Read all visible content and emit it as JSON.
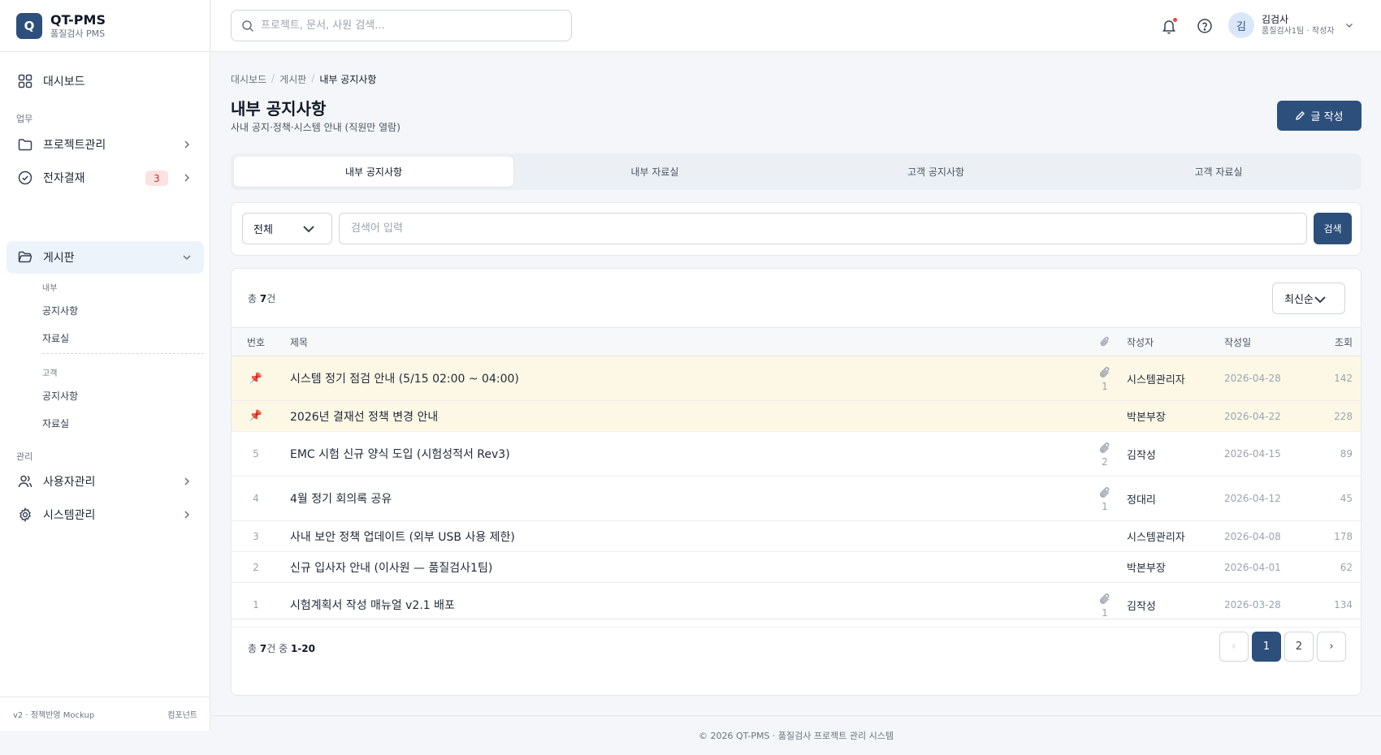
{
  "brand": {
    "logo_letter": "Q",
    "name": "QT-PMS",
    "subtitle": "품질검사 PMS"
  },
  "sidebar": {
    "dashboard": "대시보드",
    "section_work": "업무",
    "items": [
      {
        "label": "프로젝트관리",
        "icon": "folder-icon"
      },
      {
        "label": "전자결재",
        "icon": "check-circle-icon",
        "badge": "3"
      },
      {
        "label": "게시판",
        "icon": "folder-open-icon"
      }
    ],
    "board_sub": {
      "internal_label": "내부",
      "internal_items": [
        "공지사항",
        "자료실"
      ],
      "customer_label": "고객",
      "customer_items": [
        "공지사항",
        "자료실"
      ]
    },
    "section_admin": "관리",
    "admin_items": [
      {
        "label": "사용자관리",
        "icon": "users-icon"
      },
      {
        "label": "시스템관리",
        "icon": "gear-icon"
      }
    ],
    "footer_left": "v2 · 정책반영 Mockup",
    "footer_right": "컴포넌트"
  },
  "topbar": {
    "search_placeholder": "프로젝트, 문서, 사원 검색...",
    "user": {
      "avatar": "김",
      "name": "김검사",
      "role": "품질검사1팀 · 작성자"
    }
  },
  "breadcrumb": [
    "대시보드",
    "게시판",
    "내부 공지사항"
  ],
  "page": {
    "title": "내부 공지사항",
    "subtitle": "사내 공지·정책·시스템 안내 (직원만 열람)",
    "write_button": "글 작성"
  },
  "tabs": [
    "내부 공지사항",
    "내부 자료실",
    "고객 공지사항",
    "고객 자료실"
  ],
  "filter": {
    "select_value": "전체",
    "input_placeholder": "검색어 입력",
    "search_button": "검색"
  },
  "list": {
    "total_prefix": "총 ",
    "total_count": "7",
    "total_suffix": "건",
    "sort_value": "최신순",
    "headers": {
      "no": "번호",
      "title": "제목",
      "author": "작성자",
      "date": "작성일",
      "views": "조회"
    },
    "rows": [
      {
        "no": "",
        "pinned": true,
        "title": "시스템 정기 점검 안내 (5/15 02:00 ~ 04:00)",
        "attachments": "1",
        "author": "시스템관리자",
        "date": "2026-04-28",
        "views": "142"
      },
      {
        "no": "",
        "pinned": true,
        "title": "2026년 결재선 정책 변경 안내",
        "attachments": "",
        "author": "박본부장",
        "date": "2026-04-22",
        "views": "228"
      },
      {
        "no": "5",
        "pinned": false,
        "title": "EMC 시험 신규 양식 도입 (시험성적서 Rev3)",
        "attachments": "2",
        "author": "김작성",
        "date": "2026-04-15",
        "views": "89"
      },
      {
        "no": "4",
        "pinned": false,
        "title": "4월 정기 회의록 공유",
        "attachments": "1",
        "author": "정대리",
        "date": "2026-04-12",
        "views": "45"
      },
      {
        "no": "3",
        "pinned": false,
        "title": "사내 보안 정책 업데이트 (외부 USB 사용 제한)",
        "attachments": "",
        "author": "시스템관리자",
        "date": "2026-04-08",
        "views": "178"
      },
      {
        "no": "2",
        "pinned": false,
        "title": "신규 입사자 안내 (이사원 — 품질검사1팀)",
        "attachments": "",
        "author": "박본부장",
        "date": "2026-04-01",
        "views": "62"
      },
      {
        "no": "1",
        "pinned": false,
        "title": "시험계획서 작성 매뉴얼 v2.1 배포",
        "attachments": "1",
        "author": "김작성",
        "date": "2026-03-28",
        "views": "134"
      }
    ],
    "pagination": {
      "summary_prefix": "총 ",
      "summary_count": "7",
      "summary_mid": "건 중 ",
      "summary_range": "1-20",
      "prev": "‹",
      "pages": [
        "1",
        "2"
      ],
      "current": "1",
      "next": "›"
    }
  },
  "footer": "© 2026 QT-PMS · 품질검사 프로젝트 관리 시스템",
  "colors": {
    "primary": "#2d4f7c",
    "pinned_row": "#fdf8e6",
    "active_nav": "#edf3fb",
    "badge_bg": "#fde2e2",
    "pin": "#d93025"
  }
}
